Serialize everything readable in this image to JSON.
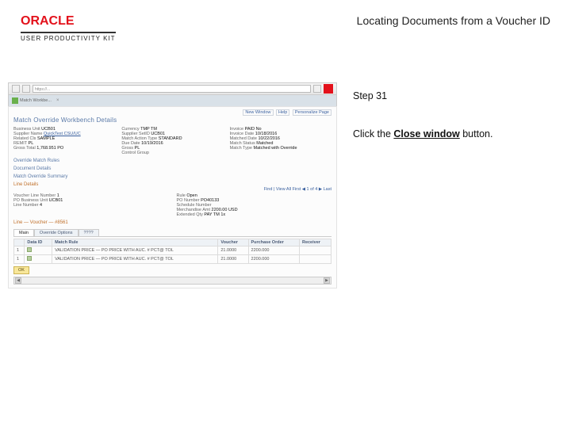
{
  "header": {
    "brand": "ORACLE",
    "product": "USER PRODUCTIVITY KIT",
    "title": "Locating Documents from a Voucher ID"
  },
  "instruction": {
    "step_label": "Step 31",
    "line_prefix": "Click the ",
    "target": "Close window",
    "line_suffix": " button."
  },
  "shot": {
    "address_text": "https://...",
    "tab_label": "Match Workbe...",
    "top_links": [
      "New Window",
      "Help",
      "Personalize Page"
    ],
    "panel_title": "Match Override Workbench Details",
    "fields_col1": [
      {
        "lbl": "Business Unit",
        "val": "UCB01",
        "linked": false
      },
      {
        "lbl": "Supplier Name",
        "val": "QuickTest CSU/UC",
        "linked": true
      },
      {
        "lbl": "Related Cls",
        "val": "SAMPLE",
        "linked": false
      },
      {
        "lbl": "REMIT",
        "val": "PL",
        "linked": false
      },
      {
        "lbl": "Gross Total",
        "val": "1,768.951     PO",
        "linked": false
      }
    ],
    "fields_col2": [
      {
        "lbl": "Currency",
        "val": "TMP TM",
        "linked": false
      },
      {
        "lbl": "Supplier SetID",
        "val": "UCB01",
        "linked": false
      },
      {
        "lbl": "Match Action Type",
        "val": "STANDARD",
        "linked": false
      },
      {
        "lbl": "Due Date",
        "val": "10/19/2016",
        "linked": false
      },
      {
        "lbl": "Gross",
        "val": "PL",
        "linked": false
      },
      {
        "lbl": "Control Group",
        "val": "",
        "linked": false
      }
    ],
    "fields_col3": [
      {
        "lbl": "Invoice",
        "val": "PAID No",
        "linked": false
      },
      {
        "lbl": "Invoice Date",
        "val": "10/18/2016",
        "linked": false
      },
      {
        "lbl": "Matched Date",
        "val": "10/22/2016",
        "linked": false
      },
      {
        "lbl": "Match Status",
        "val": "Matched",
        "linked": false
      },
      {
        "lbl": "Match Type",
        "val": "Matched with Override",
        "linked": false
      }
    ],
    "sec_links": [
      "Override Match Rules",
      "Document Details",
      "Match Override Summary"
    ],
    "line_details_title": "Line Details",
    "line_nav_text": "Find | View All    First ◀ 1 of 4 ▶ Last",
    "line_fields_left": [
      {
        "lbl": "Voucher Line Number",
        "val": "1"
      },
      {
        "lbl": "PO Business Unit",
        "val": "UCB01"
      },
      {
        "lbl": "Line Number",
        "val": "4"
      }
    ],
    "line_fields_right": [
      {
        "lbl": "Rule",
        "val": "Open"
      },
      {
        "lbl": "PO Number",
        "val": "PO40133"
      },
      {
        "lbl": "Schedule Number",
        "val": ""
      },
      {
        "lbl": "Merchandise Amt",
        "val": "2200.00 USD"
      },
      {
        "lbl": "Extended Qty",
        "val": "PAY TM     1x"
      }
    ],
    "line_voucher_label": "Line — Voucher — #8561",
    "tabs": [
      "Main",
      "Override Options",
      "????"
    ],
    "table_headers": [
      "",
      "Data ID",
      "Match Rule",
      "Voucher",
      "Purchase Order",
      "Receiver"
    ],
    "table_rows": [
      [
        "1",
        "",
        "VALIDATION PRICE — PO PRICE WITH AUC. # PCT@ TOL",
        "21.0000",
        "2200.000",
        ""
      ],
      [
        "1",
        "",
        "VALIDATION PRICE — PO PRICE WITH AUC. # PCT@ TOL",
        "21.0000",
        "2200.000",
        ""
      ]
    ],
    "action_button": "OK",
    "scroll_left": "◀",
    "scroll_right": "▶"
  }
}
